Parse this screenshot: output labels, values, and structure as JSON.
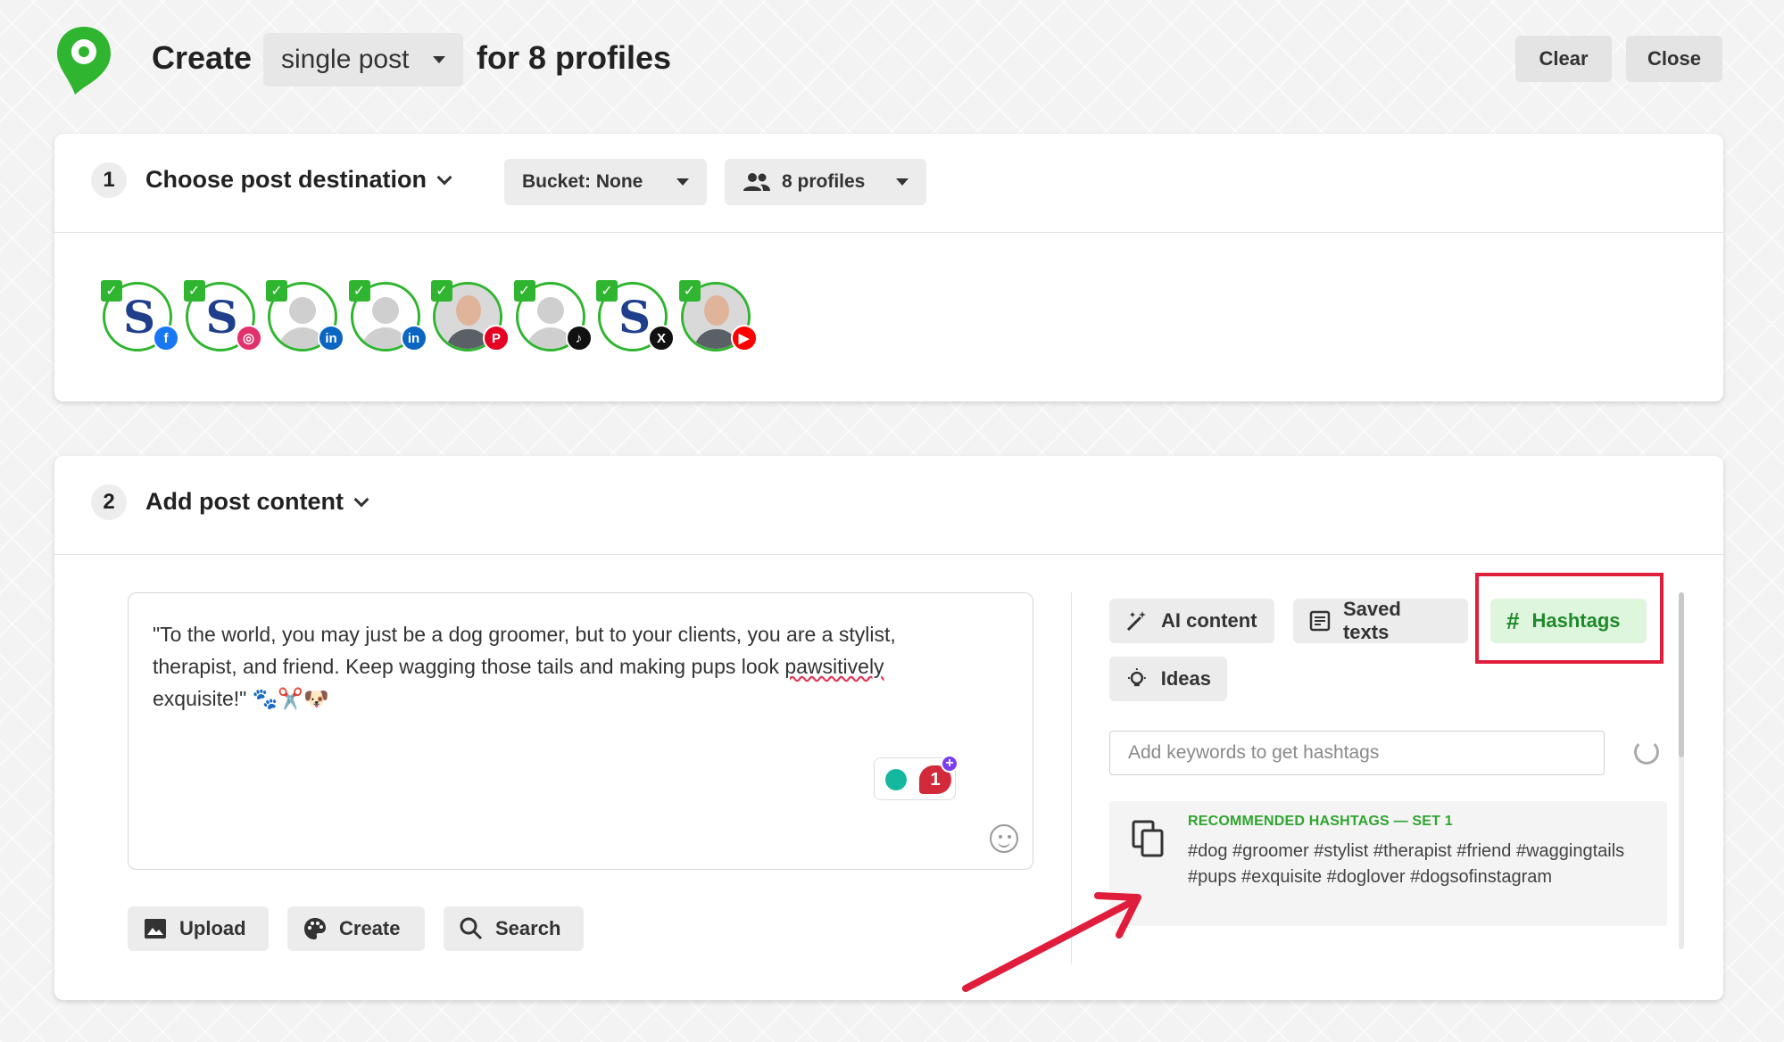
{
  "header": {
    "create_label": "Create",
    "post_type": "single post",
    "for_label": "for 8 profiles",
    "clear_label": "Clear",
    "close_label": "Close"
  },
  "destination": {
    "step": "1",
    "title": "Choose post destination",
    "bucket_label": "Bucket: None",
    "profiles_label": "8 profiles",
    "profiles": [
      {
        "avatar": "brand-logo",
        "network": "facebook",
        "color": "#1877f2"
      },
      {
        "avatar": "brand-logo",
        "network": "instagram",
        "color": "#e1306c"
      },
      {
        "avatar": "default-person",
        "network": "linkedin",
        "color": "#0a66c2"
      },
      {
        "avatar": "default-person",
        "network": "linkedin",
        "color": "#0a66c2"
      },
      {
        "avatar": "photo",
        "network": "pinterest",
        "color": "#e60023"
      },
      {
        "avatar": "default-person",
        "network": "tiktok",
        "color": "#111111"
      },
      {
        "avatar": "brand-logo",
        "network": "x",
        "color": "#111111"
      },
      {
        "avatar": "photo",
        "network": "youtube",
        "color": "#ff0000"
      }
    ]
  },
  "content": {
    "step": "2",
    "title": "Add post content",
    "text_before": "\"To the world, you may just be a dog groomer, but to your clients, you are a stylist, therapist, and friend. Keep wagging those tails and making pups look ",
    "text_misspelled": "pawsitively",
    "text_after": " exquisite!\" 🐾✂️🐶",
    "grammar_count": "1",
    "upload_label": "Upload",
    "create_label": "Create",
    "search_label": "Search"
  },
  "panel": {
    "ai_label": "AI content",
    "saved_label": "Saved texts",
    "hashtags_label": "Hashtags",
    "ideas_label": "Ideas",
    "keyword_placeholder": "Add keywords to get hashtags",
    "recommended_label": "RECOMMENDED HASHTAGS — SET 1",
    "hashtags_text": "#dog #groomer #stylist #therapist #friend #waggingtails #pups #exquisite #doglover #dogsofinstagram"
  },
  "colors": {
    "accent_green": "#2fb52f",
    "highlight_red": "#e01e3c"
  }
}
